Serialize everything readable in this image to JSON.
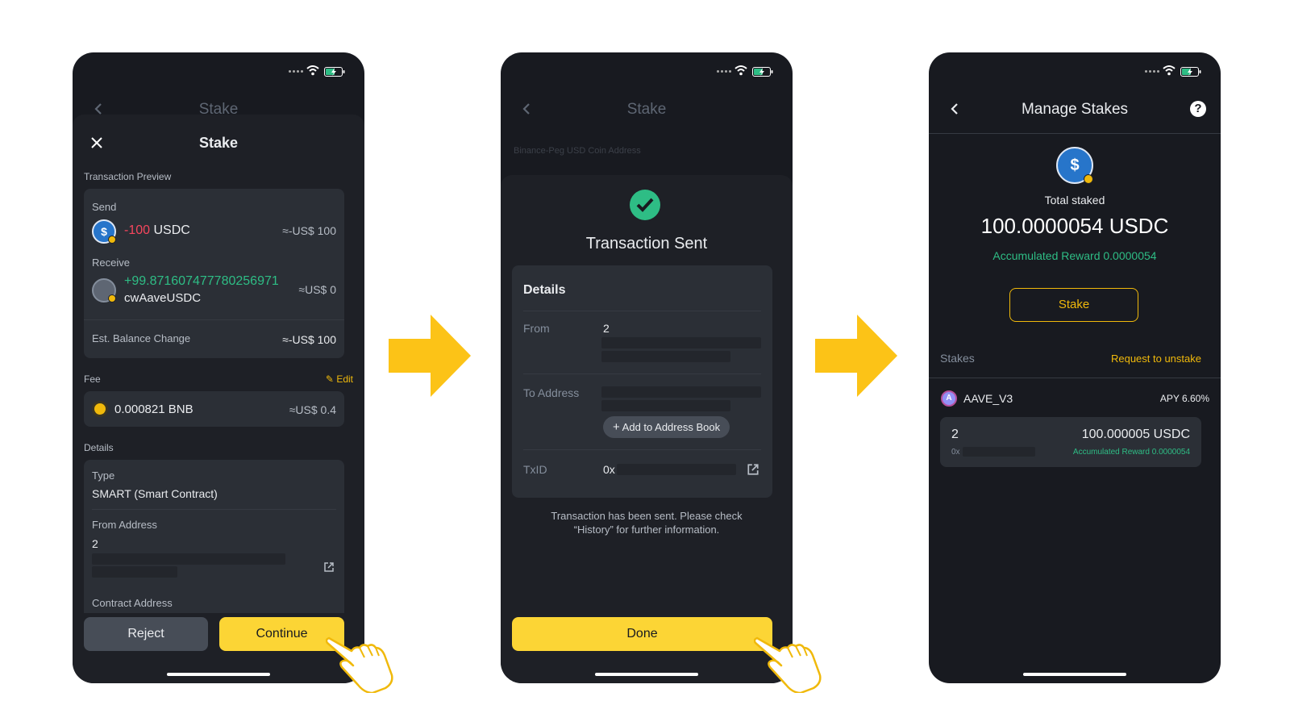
{
  "colors": {
    "accent": "#fcd535",
    "positive": "#2ebd85",
    "negative": "#f6465d",
    "background": "#181a20"
  },
  "screen1": {
    "nav_title": "Stake",
    "sheet_title": "Stake",
    "transaction_preview_label": "Transaction Preview",
    "send_label": "Send",
    "send_amount": "-100",
    "send_token": "USDC",
    "send_value": "≈-US$ 100",
    "receive_label": "Receive",
    "receive_amount": "+99.871607477780256971",
    "receive_token": "cwAaveUSDC",
    "receive_value": "≈US$ 0",
    "balance_change_label": "Est. Balance Change",
    "balance_change_value": "≈-US$ 100",
    "fee_label": "Fee",
    "edit_label": "Edit",
    "fee_amount": "0.000821 BNB",
    "fee_value": "≈US$ 0.4",
    "details_label": "Details",
    "type_label": "Type",
    "type_value": "SMART (Smart Contract)",
    "from_address_label": "From Address",
    "from_address_value": "2",
    "contract_address_label": "Contract Address",
    "reject_label": "Reject",
    "continue_label": "Continue"
  },
  "screen2": {
    "nav_title": "Stake",
    "bg_address_label": "Binance-Peg USD Coin Address",
    "title": "Transaction Sent",
    "details_heading": "Details",
    "from_label": "From",
    "from_value": "2",
    "to_label": "To Address",
    "add_address_label": "Add to Address Book",
    "txid_label": "TxID",
    "txid_value": "0x",
    "message_line1": "Transaction has been sent. Please check",
    "message_line2": "“History” for further information.",
    "done_label": "Done"
  },
  "screen3": {
    "nav_title": "Manage Stakes",
    "total_staked_label": "Total staked",
    "total_staked_value": "100.0000054 USDC",
    "accumulated_reward": "Accumulated Reward 0.0000054",
    "stake_button": "Stake",
    "stakes_label": "Stakes",
    "request_unstake": "Request to unstake",
    "protocol_name": "AAVE_V3",
    "apy": "APY 6.60%",
    "item_id": "2",
    "item_amount": "100.000005 USDC",
    "item_address_prefix": "0x",
    "item_reward": "Accumulated Reward 0.0000054"
  }
}
